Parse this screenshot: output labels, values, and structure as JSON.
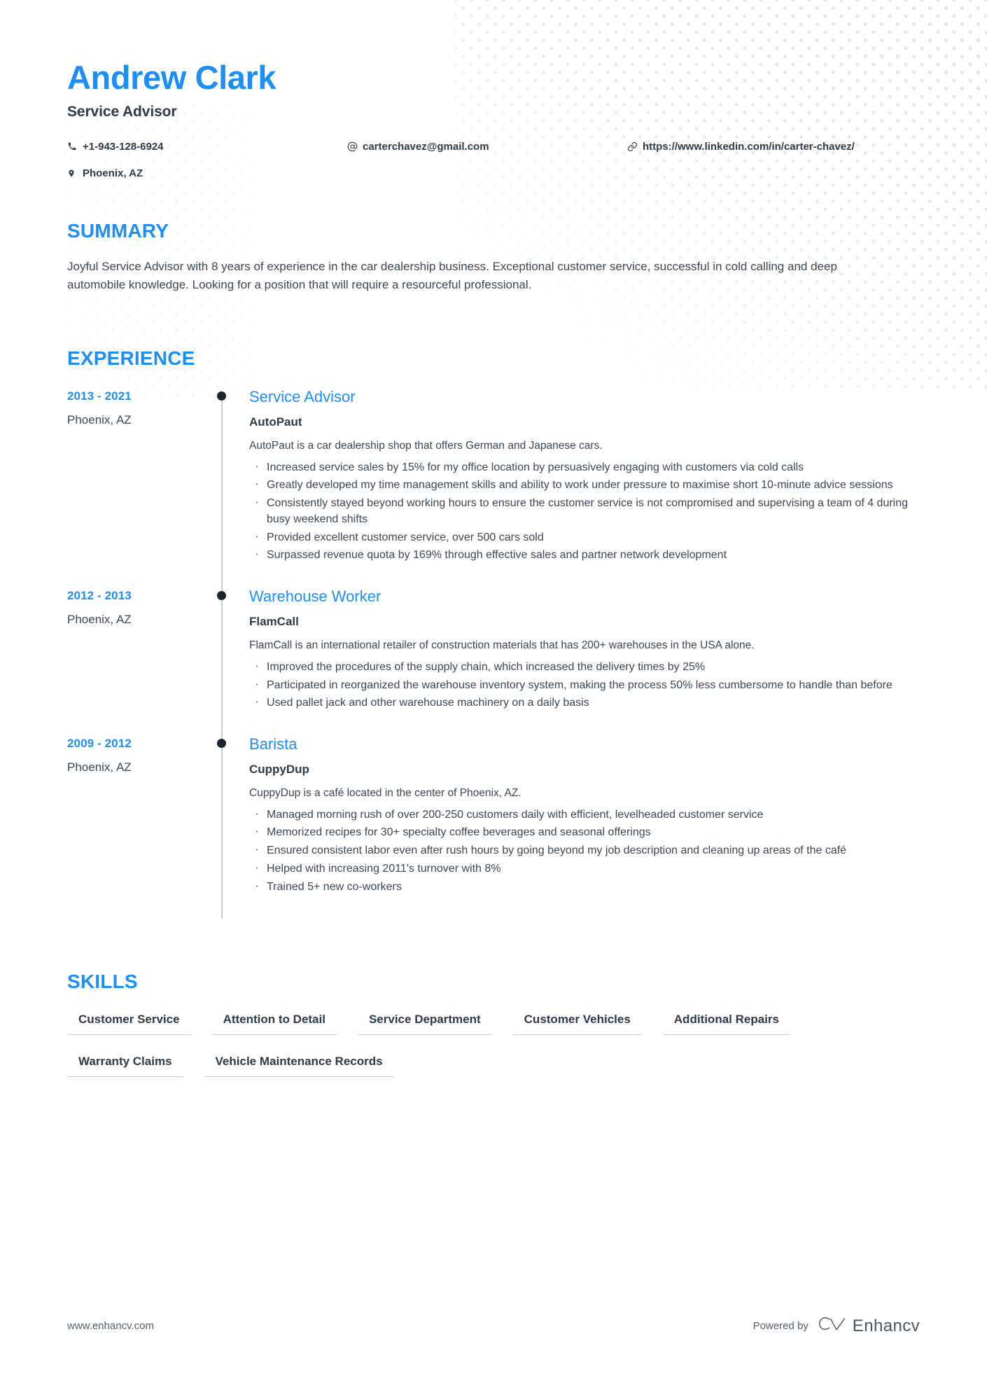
{
  "colors": {
    "accent": "#1e8ef7",
    "text_dark": "#2e3b47",
    "text_body": "#3b4754",
    "rule": "#c9ced3",
    "dot_pattern": "#e4e7e9",
    "timeline_dot": "#1b2430"
  },
  "header": {
    "name": "Andrew Clark",
    "job_title": "Service Advisor",
    "contacts": {
      "phone": "+1-943-128-6924",
      "email": "carterchavez@gmail.com",
      "link": "https://www.linkedin.com/in/carter-chavez/",
      "location": "Phoenix, AZ"
    },
    "icons": {
      "phone": "phone-icon",
      "email": "at-sign-icon",
      "link": "link-icon",
      "location": "map-pin-icon"
    }
  },
  "summary": {
    "heading": "SUMMARY",
    "text": "Joyful Service Advisor with 8 years of experience in the car dealership business. Exceptional customer service, successful in cold calling and deep automobile knowledge. Looking for a position that will require a resourceful professional."
  },
  "experience": {
    "heading": "EXPERIENCE",
    "items": [
      {
        "dates": "2013 - 2021",
        "location": "Phoenix, AZ",
        "role": "Service Advisor",
        "company": "AutoPaut",
        "description": "AutoPaut is a car dealership shop that offers German and Japanese cars.",
        "bullets": [
          "Increased service sales by 15% for my office location by persuasively engaging with customers via cold calls",
          "Greatly developed my time management skills and ability to work under pressure to maximise short 10-minute advice sessions",
          "Consistently stayed beyond working hours to ensure the customer service is not compromised and supervising a team of 4 during busy weekend shifts",
          "Provided excellent customer service, over 500 cars sold",
          "Surpassed revenue quota by 169% through effective sales and partner network development"
        ]
      },
      {
        "dates": "2012 - 2013",
        "location": "Phoenix, AZ",
        "role": "Warehouse Worker",
        "company": "FlamCall",
        "description": "FlamCall is an international retailer of construction materials that has 200+ warehouses in the USA alone.",
        "bullets": [
          "Improved the procedures of the supply chain, which increased the delivery times by 25%",
          "Participated in reorganized the warehouse inventory system, making the process 50% less cumbersome to handle than before",
          "Used pallet jack and other warehouse machinery on a daily basis"
        ]
      },
      {
        "dates": "2009 - 2012",
        "location": "Phoenix, AZ",
        "role": "Barista",
        "company": "CuppyDup",
        "description": "CuppyDup is a café located in the center of Phoenix, AZ.",
        "bullets": [
          "Managed morning rush of over 200-250 customers daily with efficient, levelheaded customer service",
          "Memorized recipes for 30+ specialty coffee beverages and seasonal offerings",
          "Ensured consistent labor even after rush hours by going beyond my job description and cleaning up areas of the café",
          "Helped with increasing 2011's turnover with 8%",
          "Trained 5+ new co-workers"
        ]
      }
    ]
  },
  "skills": {
    "heading": "SKILLS",
    "items": [
      "Customer Service",
      "Attention to Detail",
      "Service Department",
      "Customer Vehicles",
      "Additional Repairs",
      "Warranty Claims",
      "Vehicle Maintenance Records"
    ]
  },
  "footer": {
    "url": "www.enhancv.com",
    "powered_by_label": "Powered by",
    "brand_name": "Enhancv",
    "brand_logo_icon": "enhancv-logo-icon"
  }
}
